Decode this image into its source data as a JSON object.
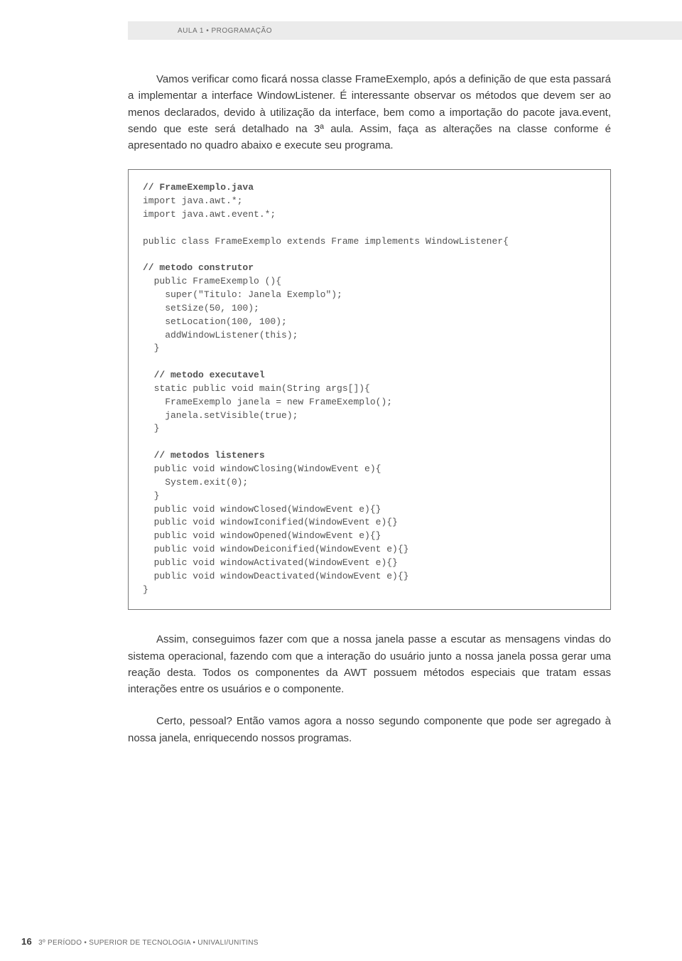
{
  "header": {
    "text": "AULA 1 • PROGRAMAÇÃO"
  },
  "p1": "Vamos verificar como ficará nossa classe FrameExemplo, após a definição de que esta passará a implementar a interface WindowListener. É interessante observar os métodos que devem ser ao menos declarados, devido à utilização da interface, bem como a importação do pacote java.event, sendo que este será detalhado na 3ª aula. Assim, faça as alterações na classe conforme é apresentado no quadro abaixo e execute seu programa.",
  "code": {
    "l01": "// FrameExemplo.java",
    "l02": "import java.awt.*;",
    "l03": "import java.awt.event.*;",
    "l04": "",
    "l05": "public class FrameExemplo extends Frame implements WindowListener{",
    "l06": "",
    "l07": "// metodo construtor",
    "l08": "  public FrameExemplo (){",
    "l09": "    super(\"Titulo: Janela Exemplo\");",
    "l10": "    setSize(50, 100);",
    "l11": "    setLocation(100, 100);",
    "l12": "    addWindowListener(this);",
    "l13": "  }",
    "l14": "",
    "l15": "  // metodo executavel",
    "l16": "  static public void main(String args[]){",
    "l17": "    FrameExemplo janela = new FrameExemplo();",
    "l18": "    janela.setVisible(true);",
    "l19": "  }",
    "l20": "",
    "l21": "  // metodos listeners",
    "l22": "  public void windowClosing(WindowEvent e){",
    "l23": "    System.exit(0);",
    "l24": "  }",
    "l25": "  public void windowClosed(WindowEvent e){}",
    "l26": "  public void windowIconified(WindowEvent e){}",
    "l27": "  public void windowOpened(WindowEvent e){}",
    "l28": "  public void windowDeiconified(WindowEvent e){}",
    "l29": "  public void windowActivated(WindowEvent e){}",
    "l30": "  public void windowDeactivated(WindowEvent e){}",
    "l31": "}"
  },
  "p2": "Assim, conseguimos fazer com que a nossa janela passe a escutar as mensagens vindas do sistema operacional, fazendo com que a interação do usuário junto a nossa janela possa gerar uma reação desta. Todos os componentes da AWT possuem métodos especiais que tratam essas interações entre os usuários e o componente.",
  "p3": "Certo, pessoal? Então vamos agora a nosso segundo componente que pode ser agregado à nossa janela, enriquecendo nossos programas.",
  "footer": {
    "page": "16",
    "text": "3º PERÍODO • SUPERIOR DE TECNOLOGIA • UNIVALI/UNITINS"
  }
}
